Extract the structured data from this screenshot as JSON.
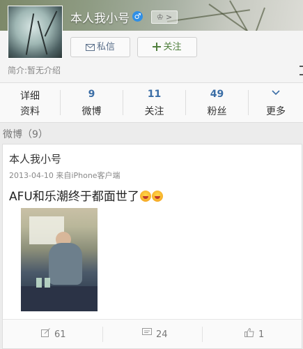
{
  "profile": {
    "username": "本人我小号",
    "gender_symbol": "♂",
    "vip_badge": "♔ >",
    "message_button": "私信",
    "follow_button": "关注",
    "intro": "简介:暂无介绍"
  },
  "stats": {
    "details": {
      "line1": "详细",
      "line2": "资料"
    },
    "weibo": {
      "count": "9",
      "label": "微博"
    },
    "following": {
      "count": "11",
      "label": "关注"
    },
    "followers": {
      "count": "49",
      "label": "粉丝"
    },
    "more": {
      "icon": "chevron-down-icon",
      "label": "更多"
    }
  },
  "section": {
    "title": "微博（9）"
  },
  "post": {
    "author": "本人我小号",
    "meta": "2013-04-10  来自iPhone客户端",
    "text": "AFU和乐潮终于都面世了",
    "reposts": "61",
    "comments": "24",
    "likes": "1"
  },
  "colors": {
    "link_blue": "#3b6ea6",
    "gender_blue": "#2f8fe6",
    "follow_green": "#4f7f3c"
  }
}
